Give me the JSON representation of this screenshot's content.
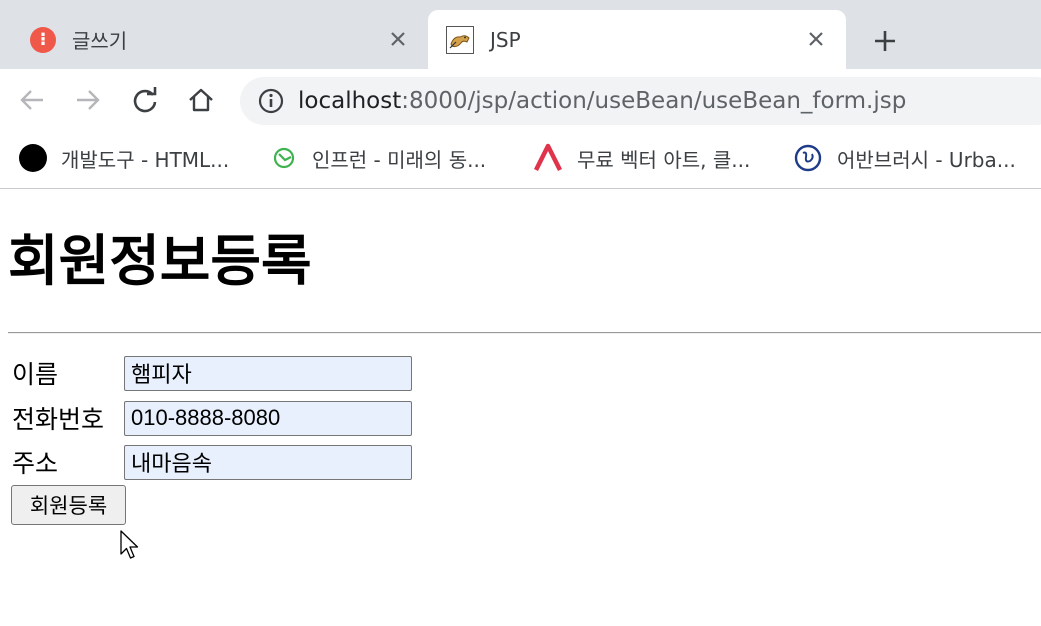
{
  "tabs": [
    {
      "title": "글쓰기",
      "active": false,
      "icon": "tistory-icon"
    },
    {
      "title": "JSP",
      "active": true,
      "icon": "tomcat-icon"
    }
  ],
  "address_bar": {
    "host": "localhost",
    "path": ":8000/jsp/action/useBean/useBean_form.jsp"
  },
  "bookmarks": [
    {
      "label": "개발도구 - HTML...",
      "icon": "black-circle-icon"
    },
    {
      "label": "인프런 - 미래의 동...",
      "icon": "inflearn-icon"
    },
    {
      "label": "무료 벡터 아트, 클...",
      "icon": "vecteezy-icon"
    },
    {
      "label": "어반브러시 -  Urba...",
      "icon": "urbanbrush-icon"
    }
  ],
  "page": {
    "title": "회원정보등록",
    "fields": [
      {
        "label": "이름",
        "value": "햄피자"
      },
      {
        "label": "전화번호",
        "value": "010-8888-8080"
      },
      {
        "label": "주소",
        "value": "내마음속"
      }
    ],
    "submit_label": "회원등록"
  },
  "colors": {
    "tabstrip": "#dee1e6",
    "autofill": "#e8f0fe",
    "tistory_red": "#f0584a",
    "inflearn_green": "#3fb34f",
    "vecteezy_red": "#e0344c",
    "urbanbrush_blue": "#1f3c88"
  }
}
